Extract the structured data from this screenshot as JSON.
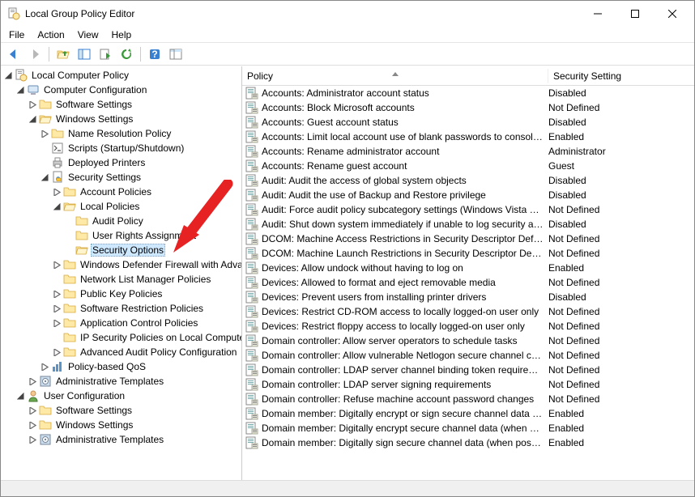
{
  "window": {
    "title": "Local Group Policy Editor"
  },
  "menu": {
    "file": "File",
    "action": "Action",
    "view": "View",
    "help": "Help"
  },
  "columns": {
    "policy": "Policy",
    "setting": "Security Setting"
  },
  "tree": {
    "root": "Local Computer Policy",
    "computer_config": "Computer Configuration",
    "software_settings": "Software Settings",
    "windows_settings": "Windows Settings",
    "name_res": "Name Resolution Policy",
    "scripts": "Scripts (Startup/Shutdown)",
    "deployed_printers": "Deployed Printers",
    "security_settings": "Security Settings",
    "account_policies": "Account Policies",
    "local_policies": "Local Policies",
    "audit_policy": "Audit Policy",
    "user_rights": "User Rights Assignment",
    "security_options": "Security Options",
    "wdfw": "Windows Defender Firewall with Advanced Security",
    "nlm": "Network List Manager Policies",
    "pkp": "Public Key Policies",
    "srp": "Software Restriction Policies",
    "acp": "Application Control Policies",
    "ipsec": "IP Security Policies on Local Computer",
    "aap": "Advanced Audit Policy Configuration",
    "pqos": "Policy-based QoS",
    "admin_templates": "Administrative Templates",
    "user_config": "User Configuration",
    "u_software": "Software Settings",
    "u_windows": "Windows Settings",
    "u_admin": "Administrative Templates"
  },
  "policies": [
    {
      "name": "Accounts: Administrator account status",
      "val": "Disabled"
    },
    {
      "name": "Accounts: Block Microsoft accounts",
      "val": "Not Defined"
    },
    {
      "name": "Accounts: Guest account status",
      "val": "Disabled"
    },
    {
      "name": "Accounts: Limit local account use of blank passwords to console logon only",
      "val": "Enabled"
    },
    {
      "name": "Accounts: Rename administrator account",
      "val": "Administrator"
    },
    {
      "name": "Accounts: Rename guest account",
      "val": "Guest"
    },
    {
      "name": "Audit: Audit the access of global system objects",
      "val": "Disabled"
    },
    {
      "name": "Audit: Audit the use of Backup and Restore privilege",
      "val": "Disabled"
    },
    {
      "name": "Audit: Force audit policy subcategory settings (Windows Vista or later)",
      "val": "Not Defined"
    },
    {
      "name": "Audit: Shut down system immediately if unable to log security audits",
      "val": "Disabled"
    },
    {
      "name": "DCOM: Machine Access Restrictions in Security Descriptor Definition Language",
      "val": "Not Defined"
    },
    {
      "name": "DCOM: Machine Launch Restrictions in Security Descriptor Definition Language",
      "val": "Not Defined"
    },
    {
      "name": "Devices: Allow undock without having to log on",
      "val": "Enabled"
    },
    {
      "name": "Devices: Allowed to format and eject removable media",
      "val": "Not Defined"
    },
    {
      "name": "Devices: Prevent users from installing printer drivers",
      "val": "Disabled"
    },
    {
      "name": "Devices: Restrict CD-ROM access to locally logged-on user only",
      "val": "Not Defined"
    },
    {
      "name": "Devices: Restrict floppy access to locally logged-on user only",
      "val": "Not Defined"
    },
    {
      "name": "Domain controller: Allow server operators to schedule tasks",
      "val": "Not Defined"
    },
    {
      "name": "Domain controller: Allow vulnerable Netlogon secure channel connections",
      "val": "Not Defined"
    },
    {
      "name": "Domain controller: LDAP server channel binding token requirements",
      "val": "Not Defined"
    },
    {
      "name": "Domain controller: LDAP server signing requirements",
      "val": "Not Defined"
    },
    {
      "name": "Domain controller: Refuse machine account password changes",
      "val": "Not Defined"
    },
    {
      "name": "Domain member: Digitally encrypt or sign secure channel data (always)",
      "val": "Enabled"
    },
    {
      "name": "Domain member: Digitally encrypt secure channel data (when possible)",
      "val": "Enabled"
    },
    {
      "name": "Domain member: Digitally sign secure channel data (when possible)",
      "val": "Enabled"
    }
  ]
}
